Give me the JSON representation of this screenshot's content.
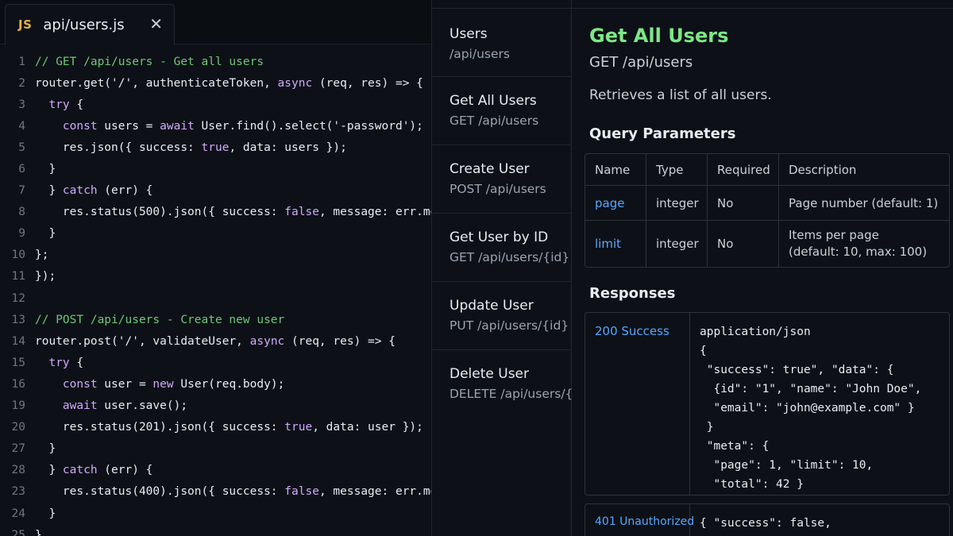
{
  "editor": {
    "tab": {
      "icon": "JS",
      "filename": "api/users.js",
      "close": "✕"
    },
    "lines": [
      {
        "num": "1",
        "tokens": [
          [
            "comment",
            "// GET /api/users - Get all users"
          ]
        ]
      },
      {
        "num": "2",
        "tokens": [
          [
            "plain",
            "router.get('/', authenticateToken, "
          ],
          [
            "keyword",
            "async"
          ],
          [
            "plain",
            " (req, res) => {"
          ]
        ]
      },
      {
        "num": "3",
        "tokens": [
          [
            "plain",
            "  "
          ],
          [
            "keyword",
            "try"
          ],
          [
            "plain",
            " {"
          ]
        ]
      },
      {
        "num": "4",
        "tokens": [
          [
            "plain",
            "    "
          ],
          [
            "keyword",
            "const"
          ],
          [
            "plain",
            " users = "
          ],
          [
            "keyword",
            "await"
          ],
          [
            "plain",
            " User.find().select('-password');"
          ]
        ]
      },
      {
        "num": "5",
        "tokens": [
          [
            "plain",
            "    res.json({ success: "
          ],
          [
            "bool",
            "true"
          ],
          [
            "plain",
            ", data: users });"
          ]
        ]
      },
      {
        "num": "6",
        "tokens": [
          [
            "plain",
            "  }"
          ]
        ]
      },
      {
        "num": "7",
        "tokens": [
          [
            "plain",
            "  } "
          ],
          [
            "keyword",
            "catch"
          ],
          [
            "plain",
            " (err) {"
          ]
        ]
      },
      {
        "num": "8",
        "tokens": [
          [
            "plain",
            "    res.status(500).json({ success: "
          ],
          [
            "bool",
            "false"
          ],
          [
            "plain",
            ", message: err.message });"
          ]
        ]
      },
      {
        "num": "9",
        "tokens": [
          [
            "plain",
            "  }"
          ]
        ]
      },
      {
        "num": "10",
        "tokens": [
          [
            "plain",
            "};"
          ]
        ]
      },
      {
        "num": "11",
        "tokens": [
          [
            "plain",
            "});"
          ]
        ]
      },
      {
        "num": "12",
        "tokens": [
          [
            "plain",
            ""
          ]
        ]
      },
      {
        "num": "13",
        "tokens": [
          [
            "comment",
            "// POST /api/users - Create new user"
          ]
        ]
      },
      {
        "num": "14",
        "tokens": [
          [
            "plain",
            "router.post('/', validateUser, "
          ],
          [
            "keyword",
            "async"
          ],
          [
            "plain",
            " (req, res) => {"
          ]
        ]
      },
      {
        "num": "15",
        "tokens": [
          [
            "plain",
            "  "
          ],
          [
            "keyword",
            "try"
          ],
          [
            "plain",
            " {"
          ]
        ]
      },
      {
        "num": "16",
        "tokens": [
          [
            "plain",
            "    "
          ],
          [
            "keyword",
            "const"
          ],
          [
            "plain",
            " user = "
          ],
          [
            "keyword",
            "new"
          ],
          [
            "plain",
            " User(req.body);"
          ]
        ]
      },
      {
        "num": "19",
        "tokens": [
          [
            "plain",
            "    "
          ],
          [
            "keyword",
            "await"
          ],
          [
            "plain",
            " user.save();"
          ]
        ]
      },
      {
        "num": "20",
        "tokens": [
          [
            "plain",
            "    res.status(201).json({ success: "
          ],
          [
            "bool",
            "true"
          ],
          [
            "plain",
            ", data: user });"
          ]
        ]
      },
      {
        "num": "27",
        "tokens": [
          [
            "plain",
            "  }"
          ]
        ]
      },
      {
        "num": "28",
        "tokens": [
          [
            "plain",
            "  } "
          ],
          [
            "keyword",
            "catch"
          ],
          [
            "plain",
            " (err) {"
          ]
        ]
      },
      {
        "num": "23",
        "tokens": [
          [
            "plain",
            "    res.status(400).json({ success: "
          ],
          [
            "bool",
            "false"
          ],
          [
            "plain",
            ", message: err.message });"
          ]
        ]
      },
      {
        "num": "24",
        "tokens": [
          [
            "plain",
            "  }"
          ]
        ]
      },
      {
        "num": "25",
        "tokens": [
          [
            "plain",
            "}"
          ]
        ]
      }
    ]
  },
  "nav": {
    "items": [
      {
        "title": "Users",
        "path": "/api/users"
      },
      {
        "title": "Get All Users",
        "path": "GET /api/users"
      },
      {
        "title": "Create User",
        "path": "POST /api/users"
      },
      {
        "title": "Get User by ID",
        "path": "GET /api/users/{id}"
      },
      {
        "title": "Update User",
        "path": "PUT /api/users/{id}"
      },
      {
        "title": "Delete User",
        "path": "DELETE /api/users/{id}"
      }
    ]
  },
  "docs": {
    "title": "Get All Users",
    "route": "GET /api/users",
    "description": "Retrieves a list of all users.",
    "query_heading": "Query Parameters",
    "params": {
      "headers": [
        "Name",
        "Type",
        "Required",
        "Description"
      ],
      "rows": [
        {
          "name": "page",
          "type": "integer",
          "required": "No",
          "description": "Page number (default: 1)"
        },
        {
          "name": "limit",
          "type": "integer",
          "required": "No",
          "description": "Items per page\n(default: 10, max: 100)"
        }
      ]
    },
    "responses_heading": "Responses",
    "responses": [
      {
        "code": "200 Success",
        "body": "application/json\n{\n \"success\": true\", \"data\": {\n  {id\": \"1\", \"name\": \"John Doe\",\n  \"email\": \"john@example.com\" }\n }\n \"meta\": {\n  \"page\": 1, \"limit\": 10,\n  \"total\": 42 }"
      },
      {
        "code": "401 Unauthorized",
        "body": "{ \"success\": false,"
      }
    ]
  },
  "colors": {
    "background": "#0d1117",
    "accent_green": "#7ee787",
    "link_blue": "#58a6ff",
    "keyword_purple": "#d2a8ff",
    "js_yellow": "#e3b341"
  }
}
